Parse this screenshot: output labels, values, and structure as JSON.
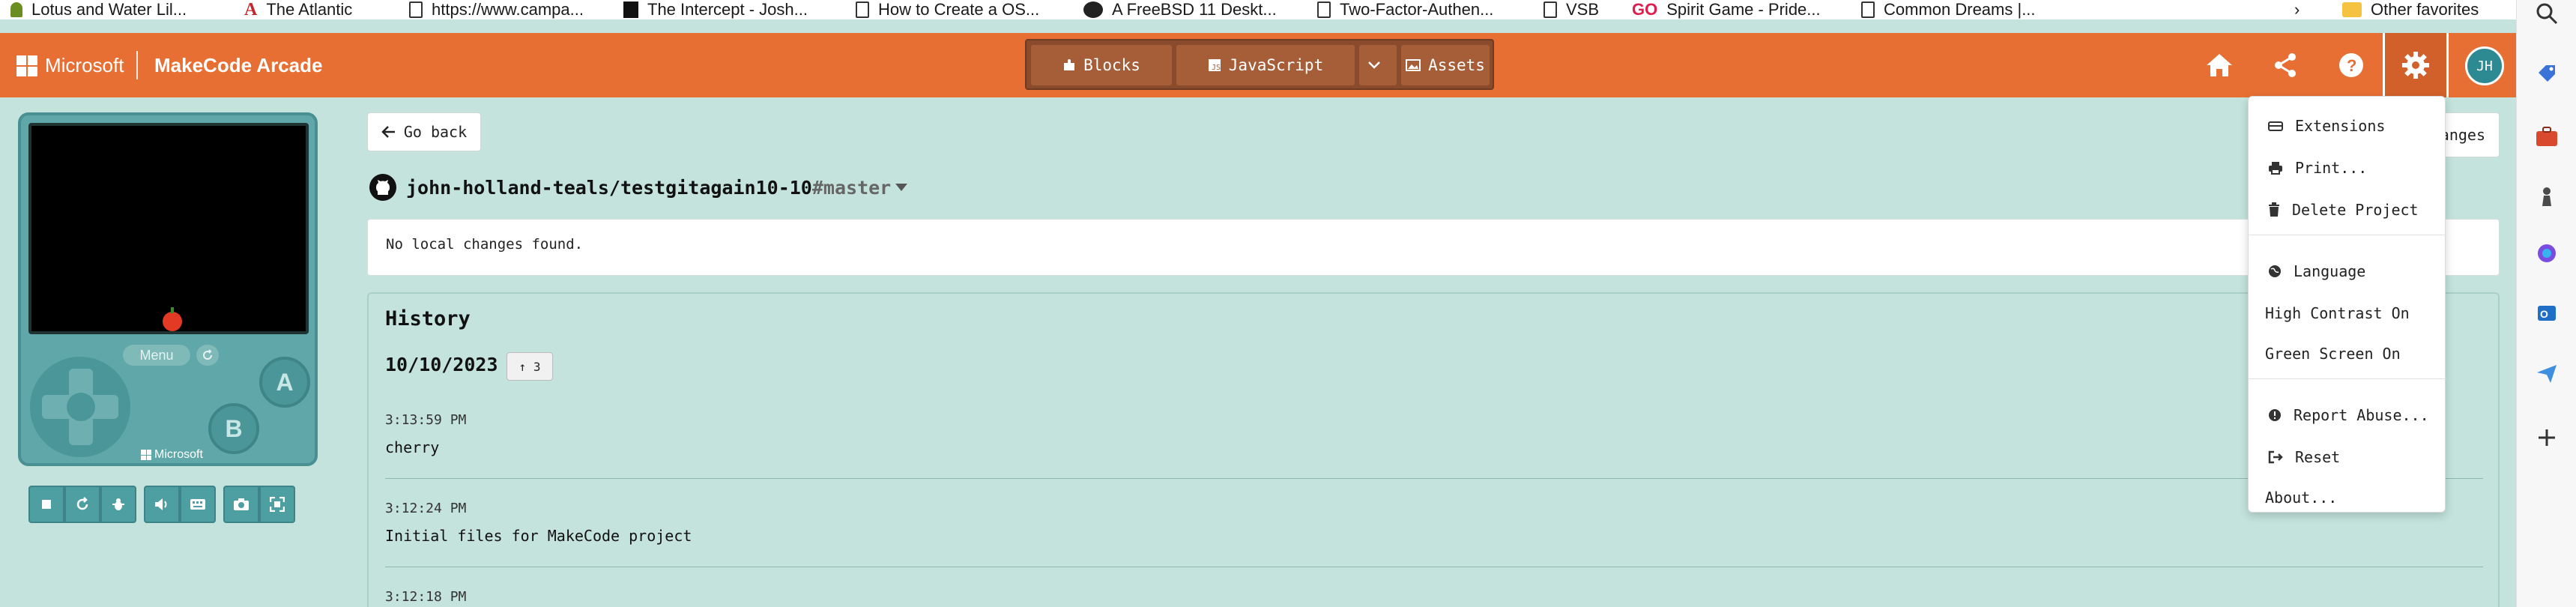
{
  "favorites": [
    {
      "label": "Lotus and Water Lil...",
      "icon": "flower-icon"
    },
    {
      "label": "The Atlantic",
      "icon": "atlantic-logo-icon"
    },
    {
      "label": "https://www.campa...",
      "icon": "page-icon"
    },
    {
      "label": "The Intercept - Josh...",
      "icon": "intercept-logo-icon"
    },
    {
      "label": "How to Create a OS...",
      "icon": "page-icon"
    },
    {
      "label": "A FreeBSD 11 Deskt...",
      "icon": "freebsd-logo-icon"
    },
    {
      "label": "Two-Factor-Authen...",
      "icon": "page-icon"
    },
    {
      "label": "VSB",
      "icon": "page-icon"
    },
    {
      "label": "Spirit Game - Pride...",
      "icon": "go-logo-icon"
    },
    {
      "label": "Common Dreams |...",
      "icon": "page-icon"
    }
  ],
  "favorites_more": "Other favorites",
  "header": {
    "microsoft": "Microsoft",
    "app_name": "MakeCode Arcade",
    "tabs": {
      "blocks": "Blocks",
      "javascript": "JavaScript",
      "assets": "Assets"
    },
    "avatar_initials": "JH"
  },
  "simulator": {
    "menu_label": "Menu",
    "button_a": "A",
    "button_b": "B",
    "brand": "Microsoft"
  },
  "main": {
    "go_back": "Go back",
    "repo_name": "john-holland-teals/testgitagain10-10",
    "branch": "#master",
    "changes_button": "anges",
    "no_changes": "No local changes found.",
    "history_title": "History",
    "history_date": "10/10/2023",
    "push_count": "↑ 3",
    "commits": [
      {
        "time": "3:13:59 PM",
        "message": "cherry"
      },
      {
        "time": "3:12:24 PM",
        "message": "Initial files for MakeCode project"
      },
      {
        "time": "3:12:18 PM",
        "message": ""
      }
    ]
  },
  "settings_menu": [
    {
      "label": "Extensions",
      "icon": "extensions-icon"
    },
    {
      "label": "Print...",
      "icon": "print-icon"
    },
    {
      "label": "Delete Project",
      "icon": "trash-icon"
    },
    {
      "label": "Language",
      "icon": "globe-icon"
    },
    {
      "label": "High Contrast On",
      "icon": ""
    },
    {
      "label": "Green Screen On",
      "icon": ""
    },
    {
      "label": "Report Abuse...",
      "icon": "alert-icon"
    },
    {
      "label": "Reset",
      "icon": "sign-out-icon"
    },
    {
      "label": "About...",
      "icon": ""
    }
  ],
  "colors": {
    "header": "#e76f34",
    "background": "#c3e3dc",
    "simulator": "#5fa7a8"
  }
}
